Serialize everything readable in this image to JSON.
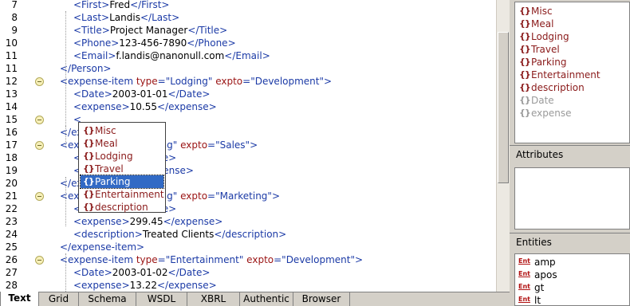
{
  "editor": {
    "lines": [
      {
        "n": "7",
        "indent": 1,
        "segs": [
          [
            "t",
            "<First>"
          ],
          [
            "x",
            "Fred"
          ],
          [
            "t",
            "</First>"
          ]
        ]
      },
      {
        "n": "8",
        "indent": 1,
        "segs": [
          [
            "t",
            "<Last>"
          ],
          [
            "x",
            "Landis"
          ],
          [
            "t",
            "</Last>"
          ]
        ]
      },
      {
        "n": "9",
        "indent": 1,
        "segs": [
          [
            "t",
            "<Title>"
          ],
          [
            "x",
            "Project Manager"
          ],
          [
            "t",
            "</Title>"
          ]
        ]
      },
      {
        "n": "10",
        "indent": 1,
        "segs": [
          [
            "t",
            "<Phone>"
          ],
          [
            "x",
            "123-456-7890"
          ],
          [
            "t",
            "</Phone>"
          ]
        ]
      },
      {
        "n": "11",
        "indent": 1,
        "segs": [
          [
            "t",
            "<Email>"
          ],
          [
            "x",
            "f.landis@nanonull.com"
          ],
          [
            "t",
            "</Email>"
          ]
        ]
      },
      {
        "n": "11",
        "indent": 0,
        "segs": [
          [
            "t",
            "</Person>"
          ]
        ]
      },
      {
        "n": "12",
        "indent": 0,
        "fold": true,
        "segs": [
          [
            "t",
            "<expense-item "
          ],
          [
            "an",
            "type"
          ],
          [
            "t",
            "="
          ],
          [
            "av",
            "\"Lodging\""
          ],
          [
            "t",
            " "
          ],
          [
            "an",
            "expto"
          ],
          [
            "t",
            "="
          ],
          [
            "av",
            "\"Development\""
          ],
          [
            "t",
            ">"
          ]
        ]
      },
      {
        "n": "13",
        "indent": 1,
        "segs": [
          [
            "t",
            "<Date>"
          ],
          [
            "x",
            "2003-01-01"
          ],
          [
            "t",
            "</Date>"
          ]
        ]
      },
      {
        "n": "14",
        "indent": 1,
        "segs": [
          [
            "t",
            "<expense>"
          ],
          [
            "x",
            "10.55"
          ],
          [
            "t",
            "</expense>"
          ]
        ]
      },
      {
        "n": "15",
        "indent": 1,
        "fold": true,
        "segs": [
          [
            "t",
            "<"
          ]
        ]
      },
      {
        "n": "16",
        "indent": 0,
        "segs": [
          [
            "t",
            "</ex"
          ]
        ]
      },
      {
        "n": "17",
        "indent": 0,
        "fold": true,
        "segs": [
          [
            "t",
            "<ex"
          ],
          [
            "x",
            "                    "
          ],
          [
            "t",
            "odging\" "
          ],
          [
            "an",
            "expto"
          ],
          [
            "t",
            "="
          ],
          [
            "av",
            "\"Sales\""
          ],
          [
            "t",
            ">"
          ]
        ]
      },
      {
        "n": "18",
        "indent": 1,
        "segs": [
          [
            "t",
            "<"
          ],
          [
            "x",
            "                    "
          ],
          [
            "t",
            "/Date>"
          ]
        ]
      },
      {
        "n": "19",
        "indent": 1,
        "segs": [
          [
            "t",
            "<"
          ],
          [
            "x",
            "                    "
          ],
          [
            "t",
            "/expense>"
          ]
        ]
      },
      {
        "n": "20",
        "indent": 0,
        "segs": [
          [
            "t",
            "</ex"
          ]
        ]
      },
      {
        "n": "21",
        "indent": 0,
        "fold": true,
        "segs": [
          [
            "t",
            "<ex"
          ],
          [
            "x",
            "                    "
          ],
          [
            "t",
            "odging\" "
          ],
          [
            "an",
            "expto"
          ],
          [
            "t",
            "="
          ],
          [
            "av",
            "\"Marketing\""
          ],
          [
            "t",
            ">"
          ]
        ]
      },
      {
        "n": "22",
        "indent": 1,
        "segs": [
          [
            "t",
            "<"
          ],
          [
            "x",
            "                    "
          ],
          [
            "t",
            "/Date>"
          ]
        ]
      },
      {
        "n": "23",
        "indent": 1,
        "segs": [
          [
            "t",
            "<expense>"
          ],
          [
            "x",
            "299.45"
          ],
          [
            "t",
            "</expense>"
          ]
        ]
      },
      {
        "n": "24",
        "indent": 1,
        "segs": [
          [
            "t",
            "<description>"
          ],
          [
            "x",
            "Treated Clients"
          ],
          [
            "t",
            "</description>"
          ]
        ]
      },
      {
        "n": "25",
        "indent": 0,
        "segs": [
          [
            "t",
            "</expense-item>"
          ]
        ]
      },
      {
        "n": "26",
        "indent": 0,
        "fold": true,
        "segs": [
          [
            "t",
            "<expense-item "
          ],
          [
            "an",
            "type"
          ],
          [
            "t",
            "="
          ],
          [
            "av",
            "\"Entertainment\""
          ],
          [
            "t",
            " "
          ],
          [
            "an",
            "expto"
          ],
          [
            "t",
            "="
          ],
          [
            "av",
            "\"Development\""
          ],
          [
            "t",
            ">"
          ]
        ]
      },
      {
        "n": "27",
        "indent": 1,
        "segs": [
          [
            "t",
            "<Date>"
          ],
          [
            "x",
            "2003-01-02"
          ],
          [
            "t",
            "</Date>"
          ]
        ]
      },
      {
        "n": "28",
        "indent": 1,
        "segs": [
          [
            "t",
            "<expense>"
          ],
          [
            "x",
            "13.22"
          ],
          [
            "t",
            "</expense>"
          ]
        ]
      }
    ]
  },
  "popup": {
    "icon": "element-icon",
    "icon_glyph": "{}",
    "items": [
      {
        "label": "Misc",
        "selected": false
      },
      {
        "label": "Meal",
        "selected": false
      },
      {
        "label": "Lodging",
        "selected": false
      },
      {
        "label": "Travel",
        "selected": false
      },
      {
        "label": "Parking",
        "selected": true
      },
      {
        "label": "Entertainment",
        "selected": false
      },
      {
        "label": "description",
        "selected": false
      }
    ]
  },
  "elements_pane": {
    "items": [
      {
        "label": "Misc",
        "dim": false
      },
      {
        "label": "Meal",
        "dim": false
      },
      {
        "label": "Lodging",
        "dim": false
      },
      {
        "label": "Travel",
        "dim": false
      },
      {
        "label": "Parking",
        "dim": false
      },
      {
        "label": "Entertainment",
        "dim": false
      },
      {
        "label": "description",
        "dim": false
      },
      {
        "label": "Date",
        "dim": true
      },
      {
        "label": "expense",
        "dim": true
      }
    ]
  },
  "attributes_pane": {
    "title": "Attributes"
  },
  "entities_pane": {
    "title": "Entities",
    "icon_glyph": "Ent",
    "items": [
      "amp",
      "apos",
      "gt",
      "lt"
    ]
  },
  "tabs": {
    "items": [
      {
        "label": "Text",
        "active": true
      },
      {
        "label": "Grid",
        "active": false
      },
      {
        "label": "Schema",
        "active": false
      },
      {
        "label": "WSDL",
        "active": false
      },
      {
        "label": "XBRL",
        "active": false
      },
      {
        "label": "Authentic",
        "active": false
      },
      {
        "label": "Browser",
        "active": false
      }
    ]
  },
  "colors": {
    "tag": "#1b3aa6",
    "attr_name": "#9a1313",
    "attr_value": "#1b3aa6",
    "element": "#8a1a1a",
    "selection": "#316ac5"
  }
}
